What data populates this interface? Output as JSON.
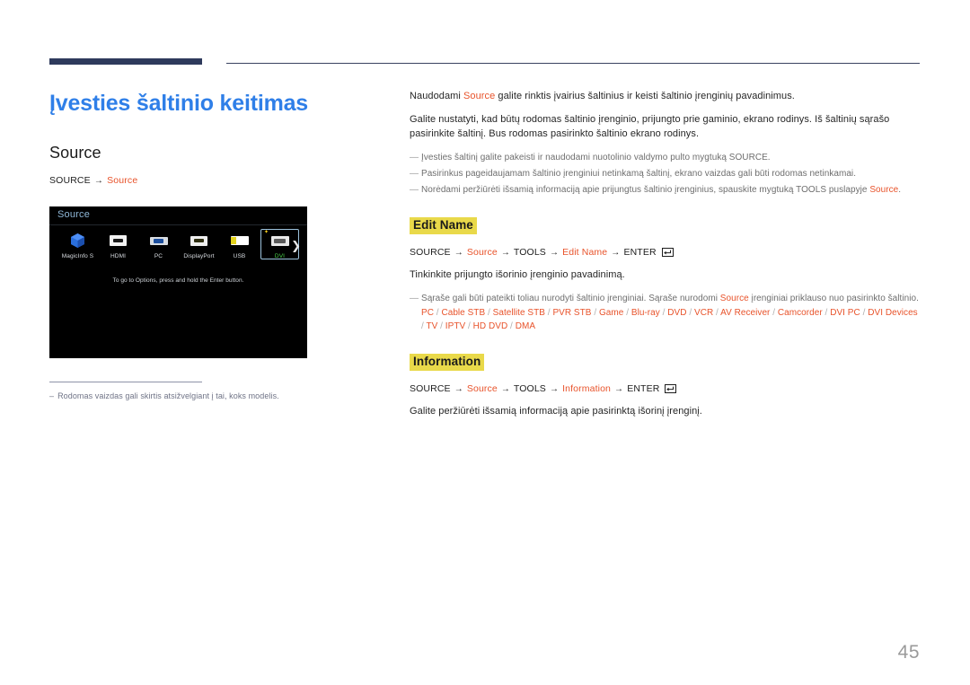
{
  "document": {
    "chapter_title": "Įvesties šaltinio keitimas",
    "section_title": "Source",
    "page_number": "45"
  },
  "left": {
    "breadcrumb": {
      "root": "SOURCE",
      "arrow": "→",
      "target": "Source"
    },
    "footnote": {
      "dash": "–",
      "text": "Rodomas vaizdas gali skirtis atsižvelgiant į tai, koks modelis."
    }
  },
  "tv_screenshot": {
    "title": "Source",
    "hint": "To go to Options, press and hold the Enter button.",
    "next_arrow": "❯",
    "star": "✦",
    "sources": [
      {
        "label": "MagicInfo S",
        "icon": "magicinfo-icon",
        "selected": false
      },
      {
        "label": "HDMI",
        "icon": "hdmi-port-icon",
        "selected": false
      },
      {
        "label": "PC",
        "icon": "vga-port-icon",
        "selected": false
      },
      {
        "label": "DisplayPort",
        "icon": "displayport-icon",
        "selected": false
      },
      {
        "label": "USB",
        "icon": "usb-drive-icon",
        "selected": false
      },
      {
        "label": "DVI",
        "icon": "dvi-port-icon",
        "selected": true
      }
    ]
  },
  "right": {
    "intro": {
      "pre": "Naudodami ",
      "highlight": "Source",
      "post": " galite rinktis įvairius šaltinius ir keisti šaltinio įrenginių pavadinimus."
    },
    "paragraph2": "Galite nustatyti, kad būtų rodomas šaltinio įrenginio, prijungto prie gaminio, ekrano rodinys. Iš šaltinių sąrašo pasirinkite šaltinį. Bus rodomas pasirinkto šaltinio ekrano rodinys.",
    "notes": [
      "Įvesties šaltinį galite pakeisti ir naudodami nuotolinio valdymo pulto mygtuką SOURCE.",
      "Pasirinkus pageidaujamam šaltinio įrenginiui netinkamą šaltinį, ekrano vaizdas gali būti rodomas netinkamai."
    ],
    "note3": {
      "pre": "Norėdami peržiūrėti išsamią informaciją apie prijungtus šaltinio įrenginius, spauskite mygtuką TOOLS puslapyje ",
      "highlight": "Source",
      "post": "."
    },
    "edit_name": {
      "heading": "Edit Name",
      "path": {
        "p1": "SOURCE",
        "a1": "→",
        "p2": "Source",
        "a2": "→",
        "p3": "TOOLS",
        "a3": "→",
        "p4": "Edit Name",
        "a4": "→",
        "p5": "ENTER"
      },
      "body": "Tinkinkite prijungto išorinio įrenginio pavadinimą.",
      "note": {
        "pre": "Sąraše gali būti pateikti toliau nurodyti šaltinio įrenginiai. Sąraše nurodomi ",
        "highlight": "Source",
        "post": " įrenginiai priklauso nuo pasirinkto šaltinio."
      },
      "device_list": [
        "PC",
        "Cable STB",
        "Satellite STB",
        "PVR STB",
        "Game",
        "Blu-ray",
        "DVD",
        "VCR",
        "AV Receiver",
        "Camcorder",
        "DVI PC",
        "DVI Devices",
        "TV",
        "IPTV",
        "HD DVD",
        "DMA"
      ],
      "device_separator": " / "
    },
    "information": {
      "heading": "Information",
      "path": {
        "p1": "SOURCE",
        "a1": "→",
        "p2": "Source",
        "a2": "→",
        "p3": "TOOLS",
        "a3": "→",
        "p4": "Information",
        "a4": "→",
        "p5": "ENTER"
      },
      "body": "Galite peržiūrėti išsamią informaciją apie pasirinktą išorinį įrenginį."
    }
  },
  "colors": {
    "chapter_blue": "#2f7fe8",
    "accent_orange": "#e8532b",
    "highlight_yellow": "#e9d94a",
    "rule_navy": "#2e3a5c",
    "tv_title_blue": "#8fb8d8",
    "selected_green": "#4ad24a"
  }
}
